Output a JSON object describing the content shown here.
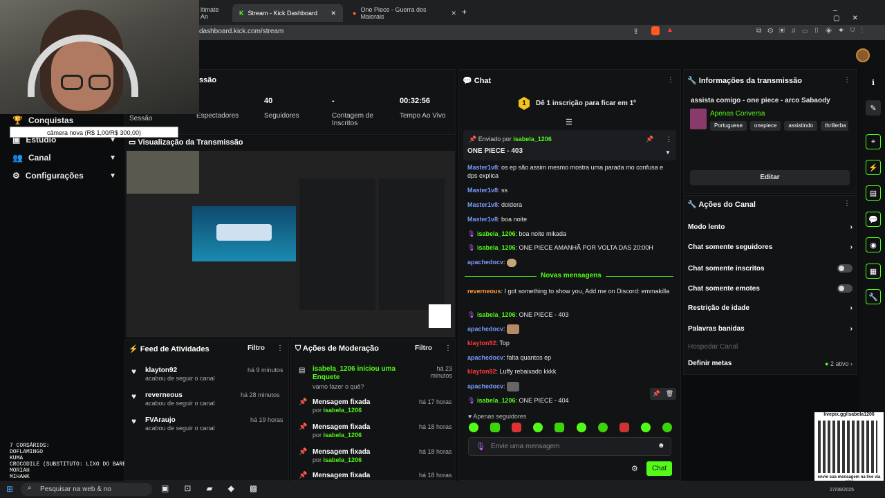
{
  "browser": {
    "tabs": [
      {
        "label": "ltimate An"
      },
      {
        "label": "Stream - Kick Dashboard"
      },
      {
        "label": "One Piece - Guerra dos Maiorais"
      }
    ],
    "url": "dashboard.kick.com/stream"
  },
  "overlay": {
    "tooltip": "câmera nova (R$ 1,00/R$ 300,00)",
    "corsarios": [
      "7 CORSÁRIOS:",
      "DOFLAMINGO",
      "KUMA",
      "CROCODILE (SUBSTITUTO: LIXO DO BARBA NEGRA)",
      "MORIAH",
      "MIHAWK"
    ],
    "qr_caption_top": "livepix.gg/isabela1206",
    "qr_caption_bottom": "envie sua mensagem na live via pix!"
  },
  "sidebar": {
    "items": [
      {
        "label": "Conquistas"
      },
      {
        "label": "Estúdio"
      },
      {
        "label": "Canal"
      },
      {
        "label": "Configurações"
      }
    ],
    "session_label": "Sessão"
  },
  "stats": {
    "title": "ssão",
    "items": [
      {
        "value": "",
        "label": "Espectadores"
      },
      {
        "value": "40",
        "label": "Seguidores"
      },
      {
        "value": "-",
        "label": "Contagem de Inscritos"
      },
      {
        "value": "00:32:56",
        "label": "Tempo Ao Vivo"
      }
    ]
  },
  "preview": {
    "title": "Visualização da Transmissão"
  },
  "feed": {
    "title": "Feed de Atividades",
    "filter": "Filtro",
    "items": [
      {
        "name": "klayton92",
        "sub": "acabou de seguir o canal",
        "time": "há 9 minutos"
      },
      {
        "name": "reverneous",
        "sub": "acabou de seguir o canal",
        "time": "há 28 minutos"
      },
      {
        "name": "FVAraujo",
        "sub": "acabou de seguir o canal",
        "time": "há 19 horas"
      }
    ]
  },
  "moderation": {
    "title": "Ações de Moderação",
    "filter": "Filtro",
    "items": [
      {
        "title": "isabela_1206 iniciou uma Enquete",
        "sub": "vamo fazer o quê?",
        "time": "há 23 minutos"
      },
      {
        "title": "Mensagem fixada",
        "by": "por",
        "user": "isabela_1206",
        "time": "há 17 horas"
      },
      {
        "title": "Mensagem fixada",
        "by": "por",
        "user": "isabela_1206",
        "time": "há 18 horas"
      },
      {
        "title": "Mensagem fixada",
        "by": "por",
        "user": "isabela_1206",
        "time": "há 18 horas"
      },
      {
        "title": "Mensagem fixada",
        "by": "",
        "user": "",
        "time": "há 18 horas"
      }
    ]
  },
  "chat": {
    "title": "Chat",
    "sub_banner": "Dê 1 inscrição para ficar em 1º",
    "sub_rank": "1",
    "pinned_by": "Enviado por",
    "pinned_user": "isabela_1206",
    "pinned_text": "ONE PIECE - 403",
    "new_messages": "Novas mensagens",
    "followers_only": "Apenas seguidores",
    "input_placeholder": "Envie uma mensagem",
    "send": "Chat",
    "messages": [
      {
        "user": "Master1v8",
        "text": "os ep são assim mesmo mostra uma parada mo confusa e dps explica",
        "color": "#7a9cff"
      },
      {
        "user": "Master1v8",
        "text": "ss",
        "color": "#7a9cff"
      },
      {
        "user": "Master1v8",
        "text": "doidera",
        "color": "#7a9cff"
      },
      {
        "user": "Master1v8",
        "text": "boa noite",
        "color": "#7a9cff"
      },
      {
        "user": "isabela_1206",
        "text": "boa noite mikada",
        "color": "#53fc18"
      },
      {
        "user": "isabela_1206",
        "text": "ONE PIECE AMANHÃ POR VOLTA DAS 20:00H",
        "color": "#53fc18"
      },
      {
        "user": "apachedocv",
        "text": "",
        "color": "#7a9cff"
      },
      {
        "user": "reverneous",
        "text": "I got something to show you, Add me on Discord: emmakilla",
        "color": "#ff9a3c"
      },
      {
        "user": "isabela_1206",
        "text": "ONE PIECE - 403",
        "color": "#53fc18"
      },
      {
        "user": "apachedocv",
        "text": "",
        "color": "#7a9cff"
      },
      {
        "user": "klayton92",
        "text": "Top",
        "color": "#ff3b3b"
      },
      {
        "user": "apachedocv",
        "text": "falta quantos ep",
        "color": "#7a9cff"
      },
      {
        "user": "klayton92",
        "text": "Luffy rebaixado kkkk",
        "color": "#ff3b3b"
      },
      {
        "user": "apachedocv",
        "text": "",
        "color": "#7a9cff"
      },
      {
        "user": "isabela_1206",
        "text": "ONE PIECE - 404",
        "color": "#53fc18"
      }
    ]
  },
  "info": {
    "title": "Informações da transmissão",
    "stream_title": "assista comigo - one piece - arco Sabaody",
    "category": "Apenas Conversa",
    "tags": [
      "Portuguese",
      "onepiece",
      "assistindo",
      "thrillerba"
    ],
    "edit": "Editar"
  },
  "actions": {
    "title": "Ações do Canal",
    "rows": [
      {
        "label": "Modo lento",
        "kind": "chevron"
      },
      {
        "label": "Chat somente seguidores",
        "kind": "chevron"
      },
      {
        "label": "Chat somente inscritos",
        "kind": "toggle"
      },
      {
        "label": "Chat somente emotes",
        "kind": "toggle"
      },
      {
        "label": "Restrição de idade",
        "kind": "chevron"
      },
      {
        "label": "Palavras banidas",
        "kind": "chevron"
      },
      {
        "label": "Hospedar Canal",
        "kind": "disabled"
      },
      {
        "label": "Definir metas",
        "kind": "badge",
        "badge": "2 ativo"
      }
    ]
  },
  "taskbar": {
    "search": "Pesquisar na web & no",
    "time": "27/08/2025"
  },
  "colors": {
    "accent": "#53fc18",
    "bg": "#0b0c0d",
    "panel": "#121314"
  }
}
